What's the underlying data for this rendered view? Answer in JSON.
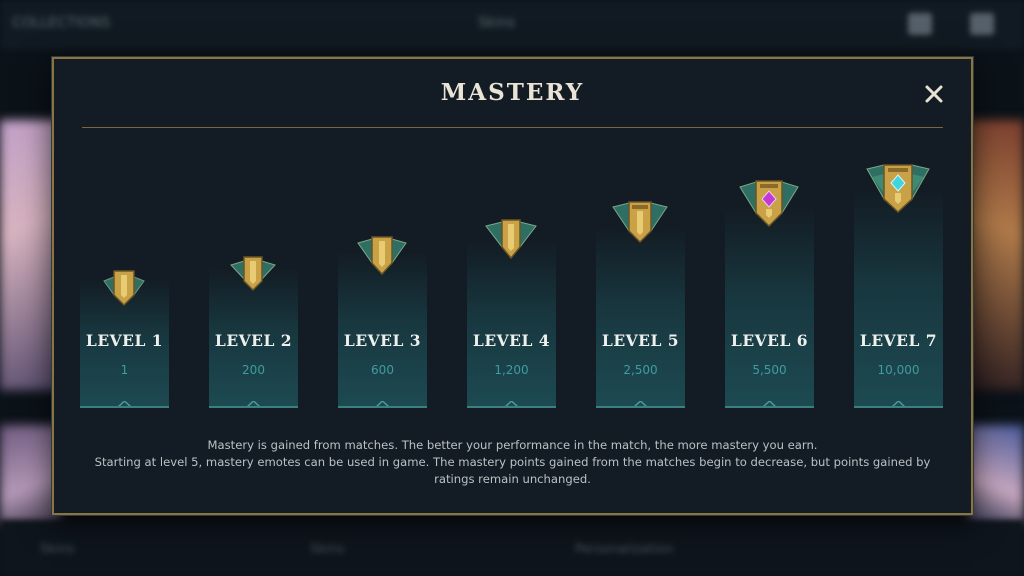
{
  "background": {
    "top_left_text": "COLLECTIONS",
    "top_center_text": "Skins",
    "bottom_texts": [
      "Skins",
      "Skins",
      "Personalization"
    ]
  },
  "modal": {
    "title": "MASTERY",
    "close_icon": "close-icon",
    "levels": [
      {
        "label": "LEVEL 1",
        "points": "1"
      },
      {
        "label": "LEVEL 2",
        "points": "200"
      },
      {
        "label": "LEVEL 3",
        "points": "600"
      },
      {
        "label": "LEVEL 4",
        "points": "1,200"
      },
      {
        "label": "LEVEL 5",
        "points": "2,500"
      },
      {
        "label": "LEVEL 6",
        "points": "5,500"
      },
      {
        "label": "LEVEL 7",
        "points": "10,000"
      }
    ],
    "description": [
      "Mastery is gained from matches. The better your performance in the match, the more mastery you earn.",
      "Starting at level 5, mastery emotes can be used in game. The mastery points gained from the matches begin to decrease, but points gained by ratings remain unchanged."
    ]
  },
  "colors": {
    "gold": "#c8a24a",
    "gold_border": "#8c7441",
    "teal_text": "#3f9ca0",
    "panel_teal": "#1d4a52",
    "gem_magenta": "#c23ad6",
    "gem_cyan": "#3fd6e0"
  }
}
